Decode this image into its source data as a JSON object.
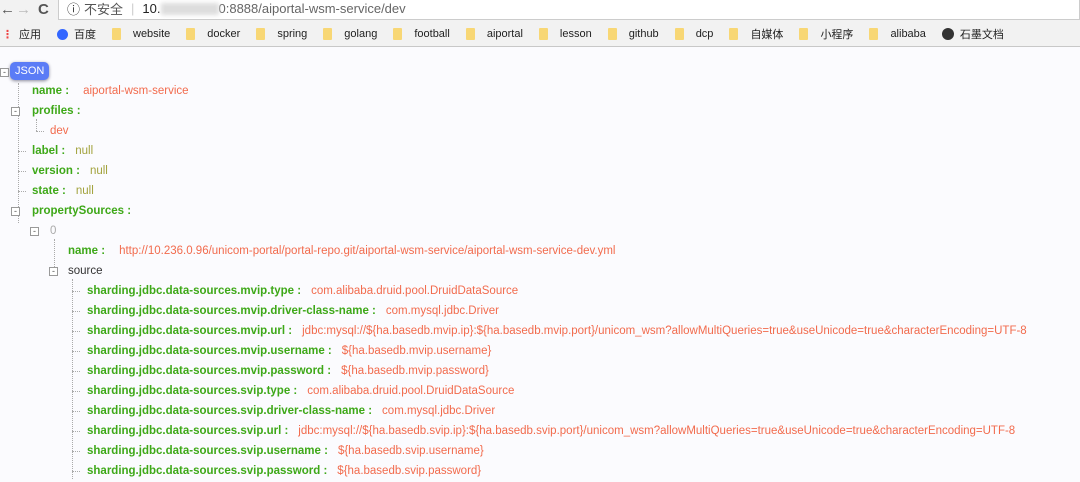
{
  "browser": {
    "back": "←",
    "forward": "→",
    "reload": "C",
    "security": "不安全",
    "url_host": "10.",
    "url_rest": "0:8888/aiportal-wsm-service/dev"
  },
  "bookmarks": [
    {
      "label": "应用",
      "icon": "apps-icon"
    },
    {
      "label": "百度",
      "icon": "baidu-icon"
    },
    {
      "label": "website",
      "icon": "folder-icon"
    },
    {
      "label": "docker",
      "icon": "folder-icon"
    },
    {
      "label": "spring",
      "icon": "folder-icon"
    },
    {
      "label": "golang",
      "icon": "folder-icon"
    },
    {
      "label": "football",
      "icon": "folder-icon"
    },
    {
      "label": "aiportal",
      "icon": "folder-icon"
    },
    {
      "label": "lesson",
      "icon": "folder-icon"
    },
    {
      "label": "github",
      "icon": "folder-icon"
    },
    {
      "label": "dcp",
      "icon": "folder-icon"
    },
    {
      "label": "自媒体",
      "icon": "folder-icon"
    },
    {
      "label": "小程序",
      "icon": "folder-icon"
    },
    {
      "label": "alibaba",
      "icon": "folder-icon"
    },
    {
      "label": "石墨文档",
      "icon": "shimo-icon"
    }
  ],
  "json": {
    "badge": "JSON",
    "name_key": "name :",
    "name_val": "aiportal-wsm-service",
    "profiles_key": "profiles :",
    "profiles_0": "dev",
    "label_key": "label :",
    "label_val": "null",
    "version_key": "version :",
    "version_val": "null",
    "state_key": "state :",
    "state_val": "null",
    "ps_key": "propertySources :",
    "ps_index": "0",
    "ps_name_key": "name :",
    "ps_name_val": "http://10.236.0.96/unicom-portal/portal-repo.git/aiportal-wsm-service/aiportal-wsm-service-dev.yml",
    "source_key": "source",
    "source": [
      {
        "k": "sharding.jdbc.data-sources.mvip.type :",
        "v": "com.alibaba.druid.pool.DruidDataSource"
      },
      {
        "k": "sharding.jdbc.data-sources.mvip.driver-class-name :",
        "v": "com.mysql.jdbc.Driver"
      },
      {
        "k": "sharding.jdbc.data-sources.mvip.url :",
        "v": "jdbc:mysql://${ha.basedb.mvip.ip}:${ha.basedb.mvip.port}/unicom_wsm?allowMultiQueries=true&useUnicode=true&characterEncoding=UTF-8"
      },
      {
        "k": "sharding.jdbc.data-sources.mvip.username :",
        "v": "${ha.basedb.mvip.username}"
      },
      {
        "k": "sharding.jdbc.data-sources.mvip.password :",
        "v": "${ha.basedb.mvip.password}"
      },
      {
        "k": "sharding.jdbc.data-sources.svip.type :",
        "v": "com.alibaba.druid.pool.DruidDataSource"
      },
      {
        "k": "sharding.jdbc.data-sources.svip.driver-class-name :",
        "v": "com.mysql.jdbc.Driver"
      },
      {
        "k": "sharding.jdbc.data-sources.svip.url :",
        "v": "jdbc:mysql://${ha.basedb.svip.ip}:${ha.basedb.svip.port}/unicom_wsm?allowMultiQueries=true&useUnicode=true&characterEncoding=UTF-8"
      },
      {
        "k": "sharding.jdbc.data-sources.svip.username :",
        "v": "${ha.basedb.svip.username}"
      },
      {
        "k": "sharding.jdbc.data-sources.svip.password :",
        "v": "${ha.basedb.svip.password}"
      }
    ]
  }
}
